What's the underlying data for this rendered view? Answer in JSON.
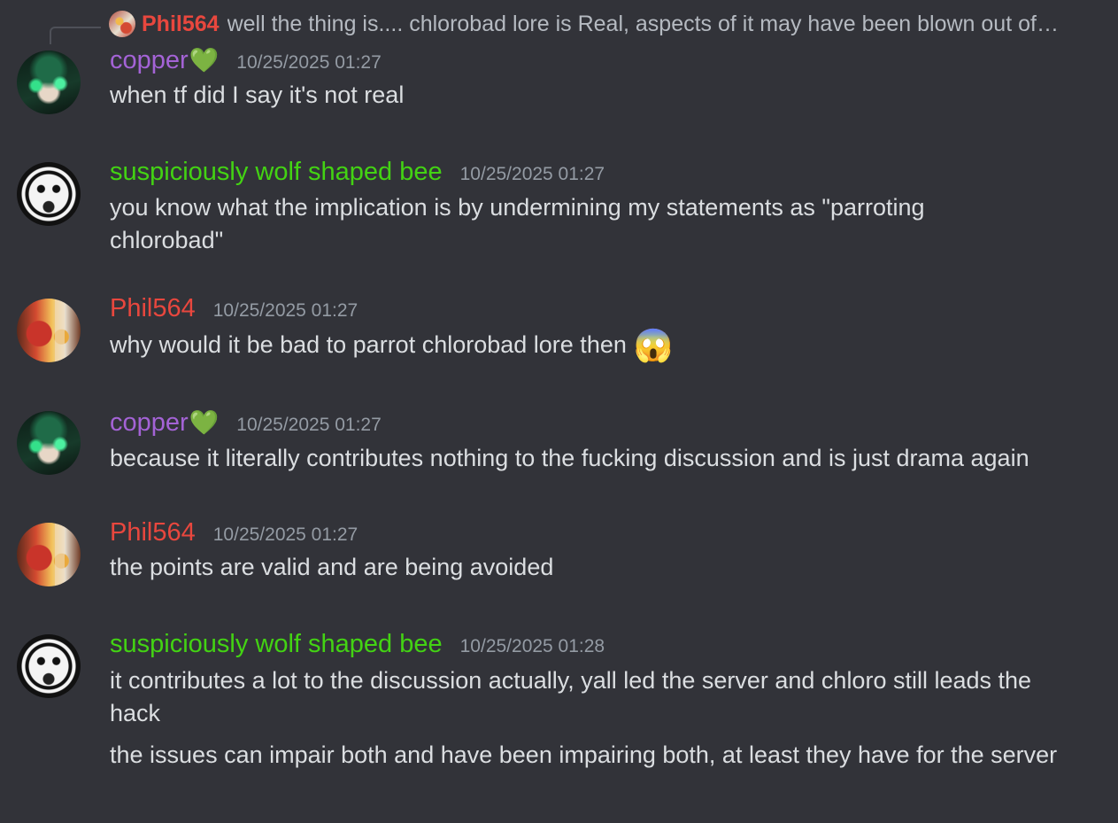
{
  "reply_preview": {
    "author": "Phil564",
    "text": "well the thing is.... chlorobad lore is Real, aspects of it may have been blown out of…"
  },
  "messages": [
    {
      "author": "copper",
      "author_emoji": "💚",
      "author_color": "#a463d6",
      "timestamp": "10/25/2025 01:27",
      "lines": [
        "when tf did I say it's not real"
      ]
    },
    {
      "author": "suspiciously wolf shaped bee",
      "author_color": "#43d313",
      "timestamp": "10/25/2025 01:27",
      "lines": [
        "you know what the implication is by undermining my statements as \"parroting chlorobad\""
      ]
    },
    {
      "author": "Phil564",
      "author_color": "#e8473e",
      "timestamp": "10/25/2025 01:27",
      "lines": [
        "why would it be bad to parrot chlorobad lore then"
      ],
      "emoji": "😱"
    },
    {
      "author": "copper",
      "author_emoji": "💚",
      "author_color": "#a463d6",
      "timestamp": "10/25/2025 01:27",
      "lines": [
        "because it literally contributes nothing to the fucking discussion and is just drama again"
      ]
    },
    {
      "author": "Phil564",
      "author_color": "#e8473e",
      "timestamp": "10/25/2025 01:27",
      "lines": [
        "the points are valid and are being avoided"
      ]
    },
    {
      "author": "suspiciously wolf shaped bee",
      "author_color": "#43d313",
      "timestamp": "10/25/2025 01:28",
      "lines": [
        "it contributes a lot to the discussion actually, yall led the server and chloro still leads the hack",
        "the issues can impair both and have been impairing both, at least they have for the server"
      ]
    }
  ]
}
